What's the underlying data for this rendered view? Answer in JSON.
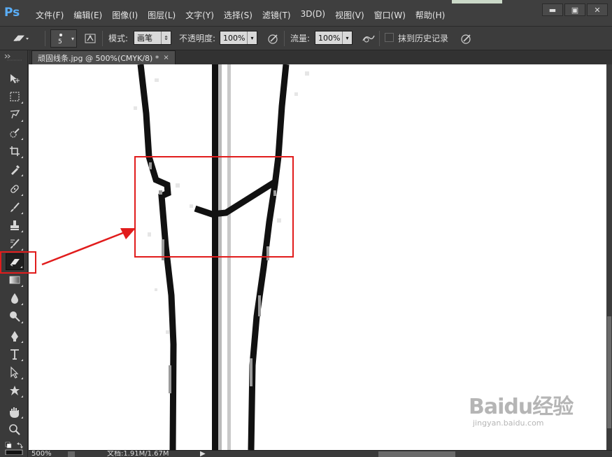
{
  "app": {
    "logo": "Ps",
    "menu": [
      "文件(F)",
      "编辑(E)",
      "图像(I)",
      "图层(L)",
      "文字(Y)",
      "选择(S)",
      "滤镜(T)",
      "3D(D)",
      "视图(V)",
      "窗口(W)",
      "帮助(H)"
    ],
    "window_buttons": [
      "▬",
      "▣",
      "✕"
    ]
  },
  "options": {
    "brush_size": "5",
    "mode_label": "模式:",
    "mode_value": "画笔",
    "opacity_label": "不透明度:",
    "opacity_value": "100%",
    "flow_label": "流量:",
    "flow_value": "100%",
    "erase_history_label": "抹到历史记录"
  },
  "document": {
    "tab_title": "顽固线条.jpg @ 500%(CMYK/8) *",
    "close_symbol": "×"
  },
  "status": {
    "zoom": "500%",
    "doc_info": "文档:1.91M/1.67M"
  },
  "toolbar": {
    "active_tool": "eraser-icon",
    "tools": [
      "move-icon",
      "marquee-icon",
      "lasso-icon",
      "quick-select-icon",
      "crop-icon",
      "eyedropper-icon",
      "healing-brush-icon",
      "brush-icon",
      "clone-stamp-icon",
      "history-brush-icon",
      "eraser-icon",
      "gradient-icon",
      "blur-icon",
      "dodge-icon",
      "pen-icon",
      "type-icon",
      "path-select-icon",
      "shape-icon",
      "hand-icon",
      "zoom-icon"
    ]
  },
  "annotation": {
    "color": "#e11c1c"
  },
  "watermark": {
    "main": "Baidu经验",
    "sub": "jingyan.baidu.com"
  }
}
